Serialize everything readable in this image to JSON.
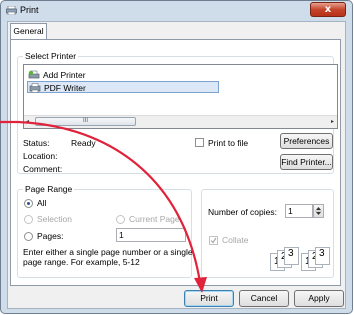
{
  "window": {
    "title": "Print",
    "close_label": "x"
  },
  "tabs": [
    {
      "label": "General"
    }
  ],
  "select_printer": {
    "label": "Select Printer",
    "printers": [
      {
        "name": "Add Printer"
      },
      {
        "name": "PDF Writer"
      }
    ],
    "selected": "PDF Writer",
    "scroll": {
      "left_arrow": "◂",
      "right_arrow": "▸",
      "thumb_grip": "III"
    }
  },
  "status": {
    "status_label": "Status:",
    "status_value": "Ready",
    "location_label": "Location:",
    "comment_label": "Comment:"
  },
  "print_to_file": {
    "label": "Print to file",
    "checked": false
  },
  "buttons": {
    "preferences": "Preferences",
    "find_printer": "Find Printer...",
    "print": "Print",
    "cancel": "Cancel",
    "apply": "Apply"
  },
  "page_range": {
    "label": "Page Range",
    "all": "All",
    "selection": "Selection",
    "current_page": "Current Page",
    "pages": "Pages:",
    "pages_value": "1",
    "help_line1": "Enter either a single page number or a single",
    "help_line2": "page range.  For example, 5-12",
    "selected_option": "All"
  },
  "copies": {
    "label": "Number of copies:",
    "value": "1",
    "collate": "Collate",
    "collate_checked": true,
    "collate_enabled": false,
    "stack_digits": [
      "1",
      "2",
      "3"
    ]
  },
  "colors": {
    "annotation_arrow": "#e0223a",
    "window_frame": "#cfdcea"
  }
}
